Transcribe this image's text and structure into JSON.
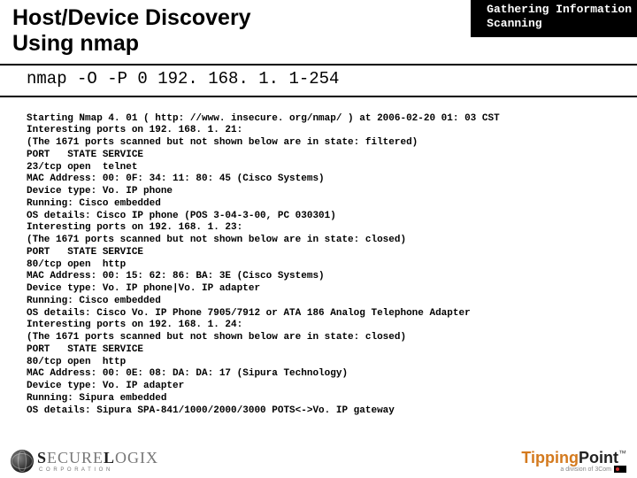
{
  "header": {
    "title_line1": "Host/Device Discovery",
    "title_line2": "Using nmap",
    "tag_line1": "Gathering Information",
    "tag_line2": "Scanning"
  },
  "command": "nmap -O -P 0 192. 168. 1. 1-254",
  "output": "Starting Nmap 4. 01 ( http: //www. insecure. org/nmap/ ) at 2006-02-20 01: 03 CST\nInteresting ports on 192. 168. 1. 21:\n(The 1671 ports scanned but not shown below are in state: filtered)\nPORT   STATE SERVICE\n23/tcp open  telnet\nMAC Address: 00: 0F: 34: 11: 80: 45 (Cisco Systems)\nDevice type: Vo. IP phone\nRunning: Cisco embedded\nOS details: Cisco IP phone (POS 3-04-3-00, PC 030301)\nInteresting ports on 192. 168. 1. 23:\n(The 1671 ports scanned but not shown below are in state: closed)\nPORT   STATE SERVICE\n80/tcp open  http\nMAC Address: 00: 15: 62: 86: BA: 3E (Cisco Systems)\nDevice type: Vo. IP phone|Vo. IP adapter\nRunning: Cisco embedded\nOS details: Cisco Vo. IP Phone 7905/7912 or ATA 186 Analog Telephone Adapter\nInteresting ports on 192. 168. 1. 24:\n(The 1671 ports scanned but not shown below are in state: closed)\nPORT   STATE SERVICE\n80/tcp open  http\nMAC Address: 00: 0E: 08: DA: DA: 17 (Sipura Technology)\nDevice type: Vo. IP adapter\nRunning: Sipura embedded\nOS details: Sipura SPA-841/1000/2000/3000 POTS<->Vo. IP gateway",
  "footer": {
    "left_brand_a": "S",
    "left_brand_b": "ECURE",
    "left_brand_c": "L",
    "left_brand_d": "OGIX",
    "left_corp": "C O R P O R A T I O N",
    "right_a": "Tipping",
    "right_b": "Point",
    "right_tm": "™",
    "right_sub": "a division of 3Com"
  }
}
